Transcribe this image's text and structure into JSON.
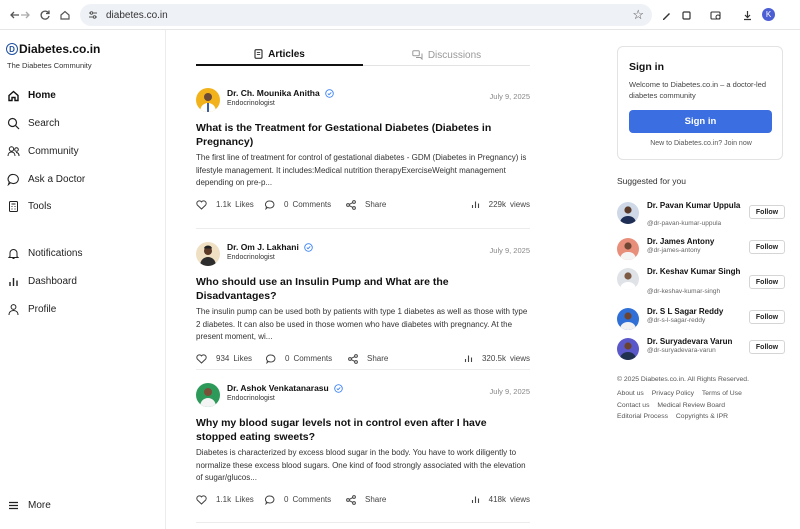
{
  "browser": {
    "url": "diabetes.co.in",
    "profile_initial": "K",
    "icons": [
      "back-icon",
      "forward-icon",
      "reload-icon",
      "home-icon",
      "site-settings-icon",
      "bookmark-star-icon",
      "pen-icon",
      "extensions-icon",
      "tab-search-icon",
      "download-icon"
    ]
  },
  "brand": {
    "name": "Diabetes.co.in",
    "logo_letter": "D",
    "tagline": "The Diabetes Community",
    "accent_color": "#3b6ee0"
  },
  "nav": {
    "items": [
      {
        "label": "Home",
        "icon": "home-icon",
        "active": true
      },
      {
        "label": "Search",
        "icon": "search-icon"
      },
      {
        "label": "Community",
        "icon": "community-icon"
      },
      {
        "label": "Ask a Doctor",
        "icon": "chat-icon"
      },
      {
        "label": "Tools",
        "icon": "calculator-icon"
      },
      {
        "label": "Notifications",
        "icon": "bell-icon"
      },
      {
        "label": "Dashboard",
        "icon": "bar-chart-icon"
      },
      {
        "label": "Profile",
        "icon": "user-icon"
      }
    ],
    "more_label": "More"
  },
  "tabs": [
    {
      "label": "Articles",
      "icon": "document-icon",
      "active": true
    },
    {
      "label": "Discussions",
      "icon": "discussion-icon",
      "active": false
    }
  ],
  "posts": [
    {
      "author": "Dr. Ch. Mounika Anitha",
      "role": "Endocrinologist",
      "date": "July 9, 2025",
      "title": "What is the Treatment for Gestational Diabetes (Diabetes in Pregnancy)",
      "excerpt": "The first line of treatment for control of gestational diabetes - GDM (Diabetes in Pregnancy) is lifestyle management. It includes:Medical nutrition therapyExerciseWeight management depending on pre-p...",
      "likes": "1.1k",
      "likes_label": "Likes",
      "comments": "0",
      "comments_label": "Comments",
      "share_label": "Share",
      "views": "229k",
      "views_label": "views"
    },
    {
      "author": "Dr. Om J. Lakhani",
      "role": "Endocrinologist",
      "date": "July 9, 2025",
      "title": "Who should use an Insulin Pump and What are the Disadvantages?",
      "excerpt": "The insulin pump can be used both by patients with type 1 diabetes as well as those with type 2 diabetes. It can also be used in those women who have diabetes with pregnancy. At the present moment, wi...",
      "likes": "934",
      "likes_label": "Likes",
      "comments": "0",
      "comments_label": "Comments",
      "share_label": "Share",
      "views": "320.5k",
      "views_label": "views"
    },
    {
      "author": "Dr. Ashok Venkatanarasu",
      "role": "Endocrinologist",
      "date": "July 9, 2025",
      "title": "Why my blood sugar levels not in control even after I have stopped eating sweets?",
      "excerpt": "Diabetes is characterized by excess blood sugar in the body. You have to work diligently to normalize these excess blood sugars. One kind of food strongly associated with the elevation of sugar/glucos...",
      "likes": "1.1k",
      "likes_label": "Likes",
      "comments": "0",
      "comments_label": "Comments",
      "share_label": "Share",
      "views": "418k",
      "views_label": "views"
    }
  ],
  "signin": {
    "title": "Sign in",
    "text": "Welcome to Diabetes.co.in – a doctor-led diabetes community",
    "button": "Sign in",
    "new_text": "New to Diabetes.co.in? Join now"
  },
  "suggested": {
    "title": "Suggested for you",
    "follow_label": "Follow",
    "people": [
      {
        "name": "Dr. Pavan Kumar Uppula",
        "handle": "@dr-pavan-kumar-uppula"
      },
      {
        "name": "Dr. James Antony",
        "handle": "@dr-james-antony"
      },
      {
        "name": "Dr. Keshav Kumar Singh",
        "handle": "@dr-keshav-kumar-singh"
      },
      {
        "name": "Dr. S L Sagar Reddy",
        "handle": "@dr-s-l-sagar-reddy"
      },
      {
        "name": "Dr. Suryadevara Varun",
        "handle": "@dr-suryadevara-varun"
      }
    ]
  },
  "footer": {
    "copyright": "© 2025 Diabetes.co.in. All Rights Reserved.",
    "links": [
      "About us",
      "Privacy Policy",
      "Terms of Use",
      "Contact us",
      "Medical Review Board",
      "Editorial Process",
      "Copyrights & IPR"
    ]
  }
}
